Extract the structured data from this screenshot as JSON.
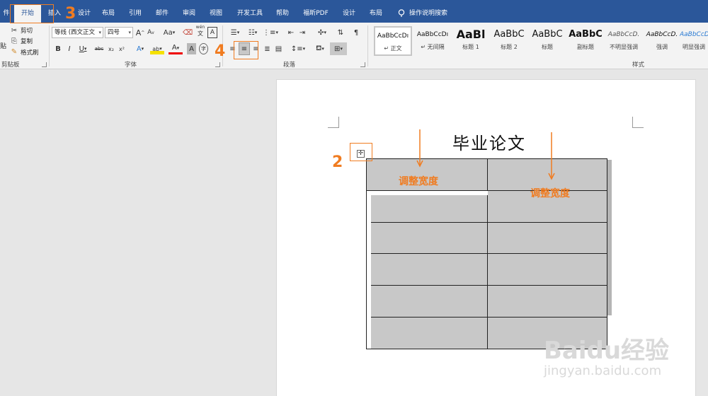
{
  "ribbon_tabs": [
    {
      "label": "件",
      "active": false
    },
    {
      "label": "开始",
      "active": true
    },
    {
      "label": "插入",
      "active": false
    },
    {
      "label": "设计",
      "active": false
    },
    {
      "label": "布局",
      "active": false
    },
    {
      "label": "引用",
      "active": false
    },
    {
      "label": "邮件",
      "active": false
    },
    {
      "label": "审阅",
      "active": false
    },
    {
      "label": "视图",
      "active": false
    },
    {
      "label": "开发工具",
      "active": false
    },
    {
      "label": "帮助",
      "active": false
    },
    {
      "label": "福昕PDF",
      "active": false
    },
    {
      "label": "设计",
      "active": false
    },
    {
      "label": "布局",
      "active": false
    }
  ],
  "tell_me": "操作说明搜索",
  "clipboard": {
    "cut": "剪切",
    "copy": "复制",
    "format_painter": "格式刷",
    "paste_fragment": "贴",
    "group_label": "剪贴板"
  },
  "font": {
    "font_name": "等线 (西文正文",
    "font_size": "四号",
    "grow": "A",
    "shrink": "A",
    "change_case": "Aa",
    "pinyin": "wén",
    "bold": "B",
    "italic": "I",
    "underline": "U",
    "strikethrough": "abc",
    "subscript": "x₂",
    "superscript": "x²",
    "text_effect": "A",
    "highlight": "ab",
    "font_color": "A",
    "char_shading": "A",
    "enclose": "字",
    "border": "A",
    "group_label": "字体"
  },
  "paragraph": {
    "group_label": "段落"
  },
  "styles": {
    "group_label": "样式",
    "items": [
      {
        "sample": "AaBbCcDı",
        "name": "↵ 正文",
        "selected": true
      },
      {
        "sample": "AaBbCcDı",
        "name": "↵ 无间隔",
        "selected": false
      },
      {
        "sample": "AaBl",
        "name": "标题 1",
        "selected": false
      },
      {
        "sample": "AaBbC",
        "name": "标题 2",
        "selected": false
      },
      {
        "sample": "AaBbC",
        "name": "标题",
        "selected": false
      },
      {
        "sample": "AaBbC",
        "name": "副标题",
        "selected": false
      },
      {
        "sample": "AaBbCcD.",
        "name": "不明显强调",
        "selected": false
      },
      {
        "sample": "AaBbCcD.",
        "name": "强调",
        "selected": false
      },
      {
        "sample": "AaBbCcD.",
        "name": "明显强调",
        "selected": false
      }
    ]
  },
  "document": {
    "title": "毕业论文",
    "table_rows": 6,
    "table_cols": 2
  },
  "annotations": {
    "step2": "2",
    "step3": "3",
    "step4": "4",
    "adjust_width_left": "调整宽度",
    "adjust_width_right": "调整宽度"
  },
  "watermark": {
    "brand": "Baidu经验",
    "url": "jingyan.baidu.com"
  },
  "colors": {
    "ribbon_blue": "#2b579a",
    "annotation_orange": "#f07c21",
    "cell_gray": "#c8c8c8"
  }
}
